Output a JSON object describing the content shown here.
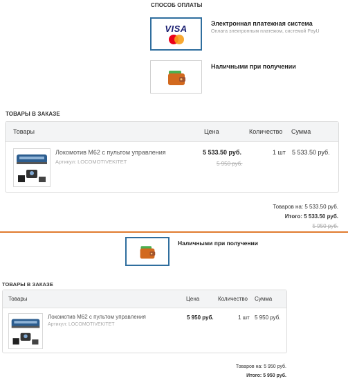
{
  "top": {
    "payment_title": "СПОСОБ ОПЛАТЫ",
    "methods": [
      {
        "name": "Электронная платежная система",
        "desc": "Оплата электронным платежом, системой PayU",
        "logo_text_1": "VISA",
        "logo_text_2": "MasterCard"
      },
      {
        "name": "Наличными при получении",
        "desc": ""
      }
    ],
    "order_title": "ТОВАРЫ В ЗАКАЗЕ",
    "headers": {
      "goods": "Товары",
      "price": "Цена",
      "qty": "Количество",
      "sum": "Сумма"
    },
    "item": {
      "name": "Локомотив М62 с пультом управления",
      "article": "Артикул: LOCOMOTIVEKITET",
      "price": "5 533.50 руб.",
      "old_price": "5 950 руб.",
      "qty": "1 шт",
      "sum": "5 533.50 руб."
    },
    "totals": {
      "goods_label": "Товаров на:",
      "goods_value": "5 533.50 руб.",
      "total_label": "Итого:",
      "total_value": "5 533.50 руб.",
      "old_total": "5 950 руб."
    }
  },
  "bottom": {
    "method_name": "Наличными при получении",
    "order_title": "ТОВАРЫ В ЗАКАЗЕ",
    "headers": {
      "goods": "Товары",
      "price": "Цена",
      "qty": "Количество",
      "sum": "Сумма"
    },
    "item": {
      "name": "Локомотив М62 с пультом управления",
      "article": "Артикул: LOCOMOTIVEKITET",
      "price": "5 950 руб.",
      "qty": "1 шт",
      "sum": "5 950 руб."
    },
    "totals": {
      "goods_label": "Товаров на:",
      "goods_value": "5 950 руб.",
      "total_label": "Итого:",
      "total_value": "5 950 руб."
    }
  },
  "colors": {
    "divider": "#e07b2e",
    "selected_border": "#2f6e9e",
    "visa_blue": "#1a1f71",
    "mc_red": "#eb001b",
    "mc_orange": "#f79e1b",
    "wallet": "#d2691e"
  },
  "icons": [
    "visa-mastercard-logo",
    "wallet-icon",
    "locomotive-product-image"
  ]
}
